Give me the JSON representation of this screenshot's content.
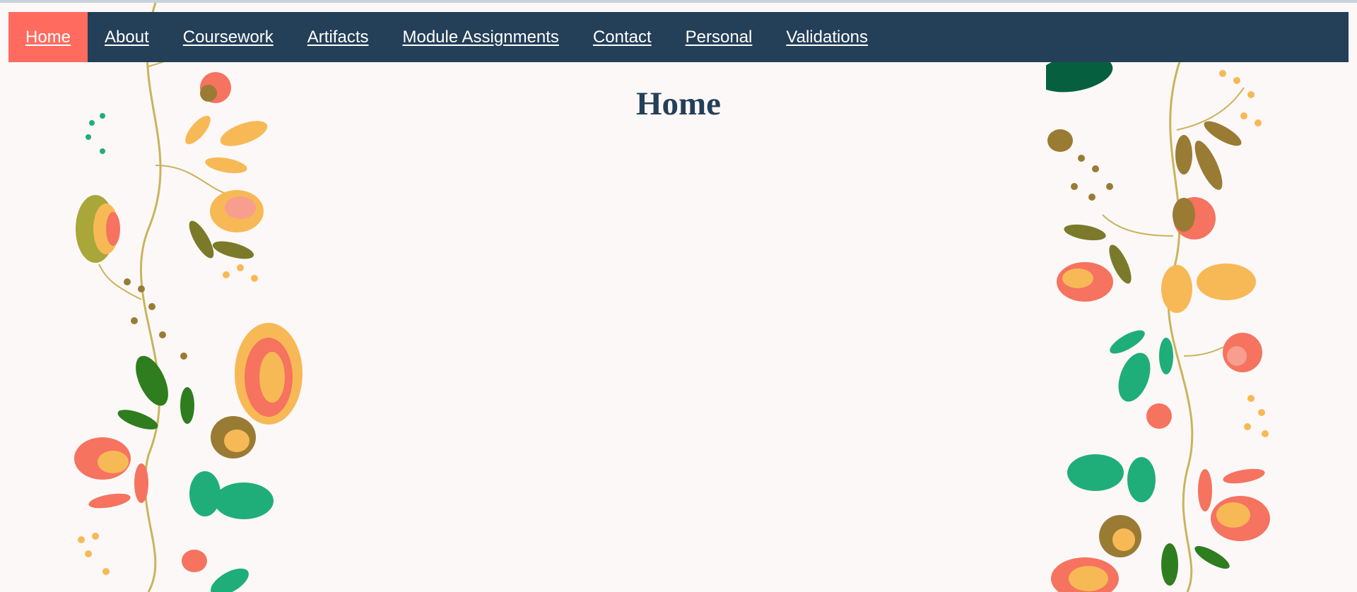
{
  "nav": {
    "items": [
      {
        "label": "Home",
        "active": true
      },
      {
        "label": "About"
      },
      {
        "label": "Coursework"
      },
      {
        "label": "Artifacts"
      },
      {
        "label": "Module Assignments"
      },
      {
        "label": "Contact"
      },
      {
        "label": "Personal"
      },
      {
        "label": "Validations"
      }
    ]
  },
  "main": {
    "title": "Home"
  },
  "colors": {
    "nav_background": "#243f58",
    "nav_active": "#ff6b5f",
    "page_background": "#fdf8f8",
    "title_color": "#243f58",
    "leaf_green": "#1fae7a",
    "flower_coral": "#f5735f",
    "flower_yellow": "#f7b955",
    "olive": "#8e8a2f"
  },
  "decor": {
    "left_icon": "floral-vine-decoration",
    "right_icon": "floral-vine-decoration"
  }
}
